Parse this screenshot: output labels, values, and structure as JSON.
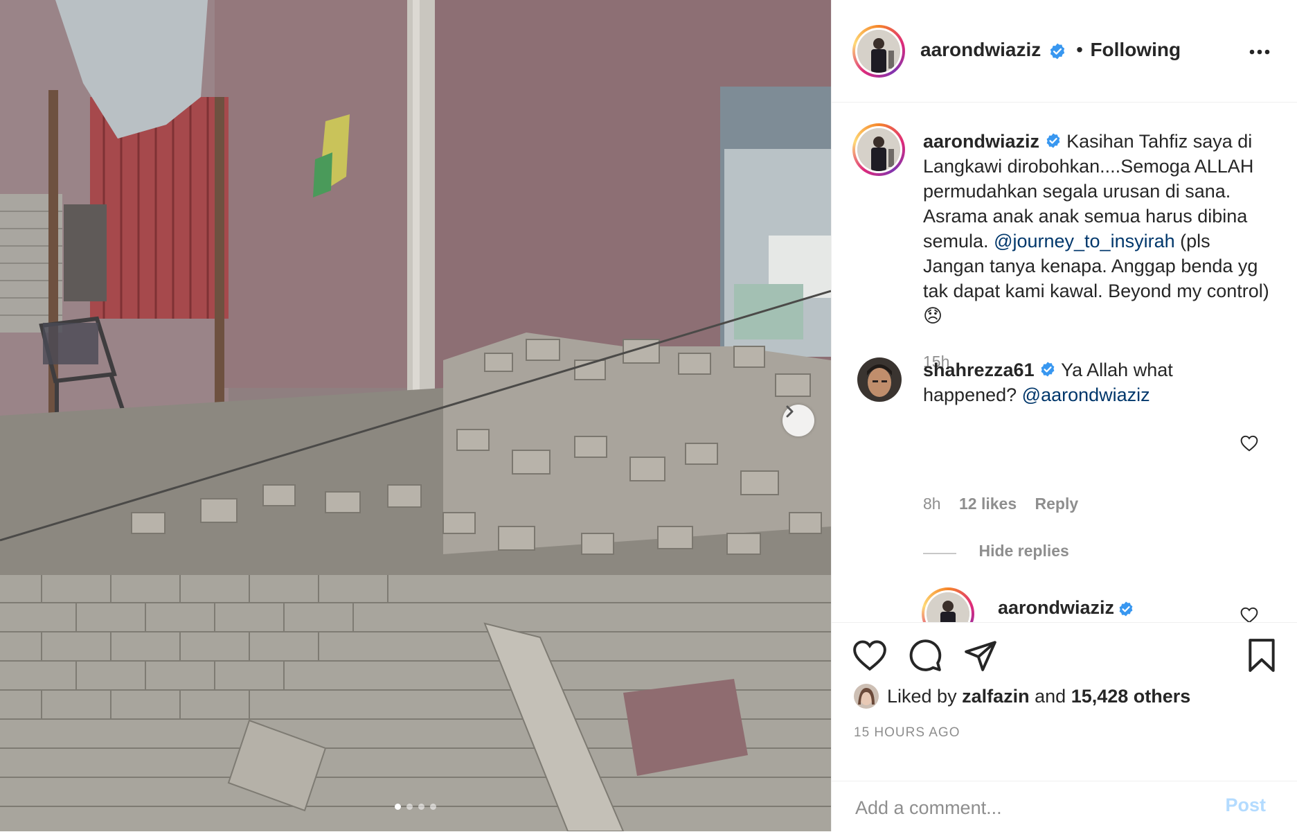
{
  "header": {
    "username": "aarondwiaziz",
    "separator": "•",
    "follow_status": "Following"
  },
  "caption": {
    "username": "aarondwiaziz",
    "text_before_mention": "Kasihan Tahfiz saya di Langkawi dirobohkan....Semoga ALLAH permudahkan segala urusan di sana. Asrama anak anak semua harus dibina semula.",
    "mention": "@journey_to_insyirah",
    "text_after_mention": "(pls Jangan tanya kenapa. Anggap benda yg tak dapat kami kawal. Beyond my control) 😞",
    "time": "15h"
  },
  "comments": [
    {
      "username": "shahrezza61",
      "text": "Ya Allah what happened?",
      "mention": "@aarondwiaziz",
      "time": "8h",
      "likes": "12 likes",
      "reply_label": "Reply",
      "hide_replies_label": "Hide replies"
    }
  ],
  "reply": {
    "username": "aarondwiaziz"
  },
  "likes": {
    "prefix": "Liked by",
    "user": "zalfazin",
    "and": "and",
    "others": "15,428 others"
  },
  "timestamp": "15 HOURS AGO",
  "add_comment": {
    "placeholder": "Add a comment...",
    "post_label": "Post"
  },
  "carousel": {
    "total_slides": 4,
    "current_slide": 1
  },
  "colors": {
    "verified": "#3897f0",
    "mention": "#00376b",
    "post_disabled": "#b3dbff",
    "secondary_text": "#8e8e8e"
  },
  "icons": [
    "verified-badge-icon",
    "more-options-icon",
    "heart-icon",
    "comment-icon",
    "share-icon",
    "bookmark-icon",
    "chevron-right-icon"
  ]
}
